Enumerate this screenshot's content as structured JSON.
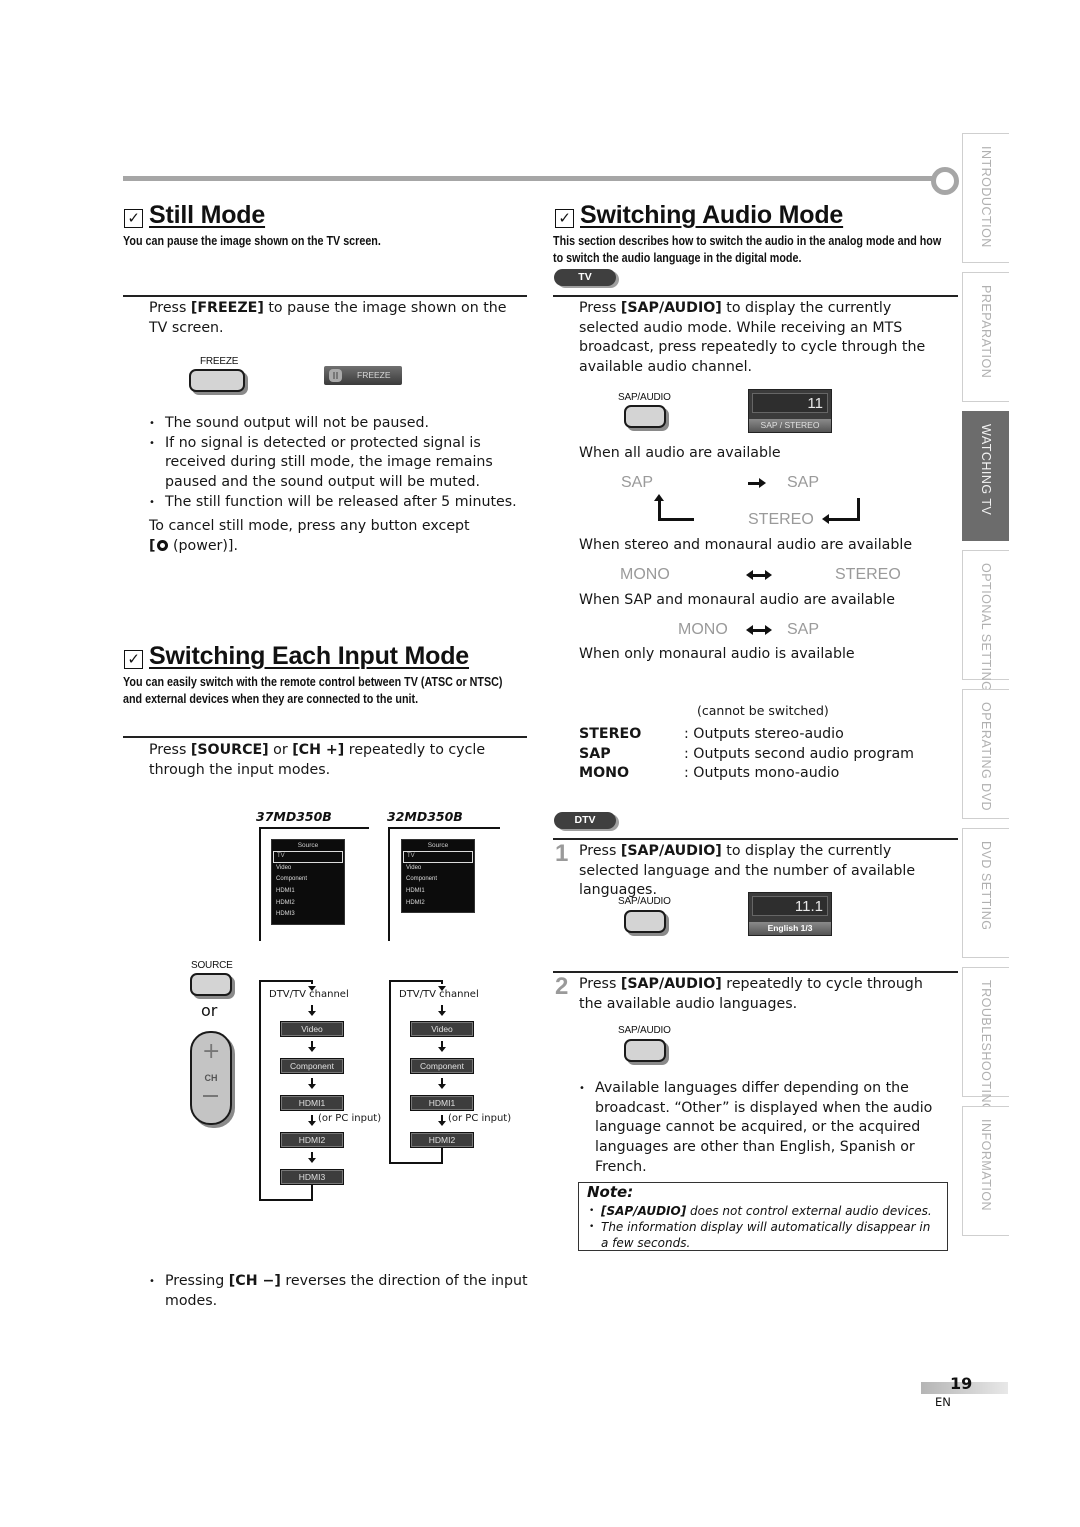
{
  "side_tabs": [
    {
      "label": "INTRODUCTION",
      "active": false
    },
    {
      "label": "PREPARATION",
      "active": false
    },
    {
      "label": "WATCHING  TV",
      "active": true
    },
    {
      "label": "OPTIONAL  SETTING",
      "active": false
    },
    {
      "label": "OPERATING  DVD",
      "active": false
    },
    {
      "label": "DVD  SETTING",
      "active": false
    },
    {
      "label": "TROUBLESHOOTING",
      "active": false
    },
    {
      "label": "INFORMATION",
      "active": false
    }
  ],
  "still_mode": {
    "checkbox": "☑",
    "title": "Still Mode",
    "subtitle": "You can pause the image shown on the TV screen.",
    "instruction_pre": "Press ",
    "instruction_key": "[FREEZE]",
    "instruction_post": " to pause the image shown on the TV screen.",
    "remote_button_label": "FREEZE",
    "osd_label": "FREEZE",
    "bullets": [
      "The sound output will not be paused.",
      "If no signal is detected or protected signal is received during still mode, the image remains paused and the sound output will be muted.",
      "The still function will be released after 5 minutes."
    ],
    "cancel_text": "To cancel still mode, press any button except",
    "cancel_key_open": "[",
    "cancel_key_text": " (power)]."
  },
  "input_mode": {
    "title": "Switching Each Input Mode",
    "subtitle_line1": "You can easily switch with the remote control between TV (ATSC or NTSC)",
    "subtitle_line2": "and external devices when they are connected to the unit.",
    "instruction_pre": "Press ",
    "instruction_key1": "[SOURCE]",
    "instruction_mid": " or ",
    "instruction_key2": "[CH +]",
    "instruction_post": " repeatedly to cycle through the input modes.",
    "models": [
      {
        "name": "37MD350B",
        "menu_header": "Source",
        "menu_items": [
          "TV",
          "Video",
          "Component",
          "HDMI1",
          "HDMI2",
          "HDMI3"
        ],
        "flow_start": "DTV/TV channel",
        "flow_boxes": [
          "Video",
          "Component",
          "HDMI1",
          "HDMI2",
          "HDMI3"
        ],
        "pc_note": "(or PC input)"
      },
      {
        "name": "32MD350B",
        "menu_header": "Source",
        "menu_items": [
          "TV",
          "Video",
          "Component",
          "HDMI1",
          "HDMI2"
        ],
        "flow_start": "DTV/TV channel",
        "flow_boxes": [
          "Video",
          "Component",
          "HDMI1",
          "HDMI2"
        ],
        "pc_note": "(or PC input)"
      }
    ],
    "source_button_label": "SOURCE",
    "or_text": "or",
    "ch_rocker": {
      "plus": "+",
      "label": "CH",
      "minus": "−"
    },
    "footer_bullet_pre": "Pressing ",
    "footer_bullet_key": "[CH −]",
    "footer_bullet_post": " reverses the direction of the input modes."
  },
  "audio_mode": {
    "title": "Switching Audio Mode",
    "subtitle_line1": "This section describes how to switch the audio in the analog mode and how",
    "subtitle_line2": "to switch the audio language in the digital mode.",
    "tv_pill": "TV",
    "tv_instruction_pre": "Press ",
    "tv_instruction_key": "[SAP/AUDIO]",
    "tv_instruction_post": " to display the currently selected audio mode. While receiving an MTS broadcast, press repeatedly to cycle through the available audio channel.",
    "remote_button_label": "SAP/AUDIO",
    "osd_tv": {
      "channel": "11",
      "status": "SAP / STEREO"
    },
    "cases": [
      {
        "label": "When all audio are available",
        "modes": [
          "SAP",
          "SAP",
          "STEREO"
        ]
      },
      {
        "label": "When stereo and monaural audio are available",
        "modes": [
          "MONO",
          "STEREO"
        ]
      },
      {
        "label": "When SAP and monaural audio are available",
        "modes": [
          "MONO",
          "SAP"
        ]
      },
      {
        "label": "When only monaural audio is available",
        "note": "(cannot be switched)"
      }
    ],
    "definitions": [
      {
        "term": "STEREO",
        "desc": ": Outputs stereo-audio"
      },
      {
        "term": "SAP",
        "desc": ": Outputs second audio program"
      },
      {
        "term": "MONO",
        "desc": ": Outputs mono-audio"
      }
    ],
    "dtv_pill": "DTV",
    "steps": [
      {
        "num": "1",
        "pre": "Press ",
        "key": "[SAP/AUDIO]",
        "post": " to display the currently selected language and the number of available languages."
      },
      {
        "num": "2",
        "pre": "Press ",
        "key": "[SAP/AUDIO]",
        "post": " repeatedly to cycle through the available audio languages."
      }
    ],
    "osd_dtv": {
      "channel": "11.1",
      "status": "English 1/3"
    },
    "languages_bullet": "Available languages differ depending on the broadcast. “Other” is displayed when the audio language cannot be acquired, or the acquired languages are other than English, Spanish or French.",
    "note": {
      "title": "Note:",
      "items": [
        {
          "key": "[SAP/AUDIO]",
          "text": " does not control external audio devices."
        },
        {
          "key": "",
          "text": "The information display will automatically disappear in a few seconds."
        }
      ]
    }
  },
  "footer": {
    "page_number": "19",
    "language": "EN"
  }
}
